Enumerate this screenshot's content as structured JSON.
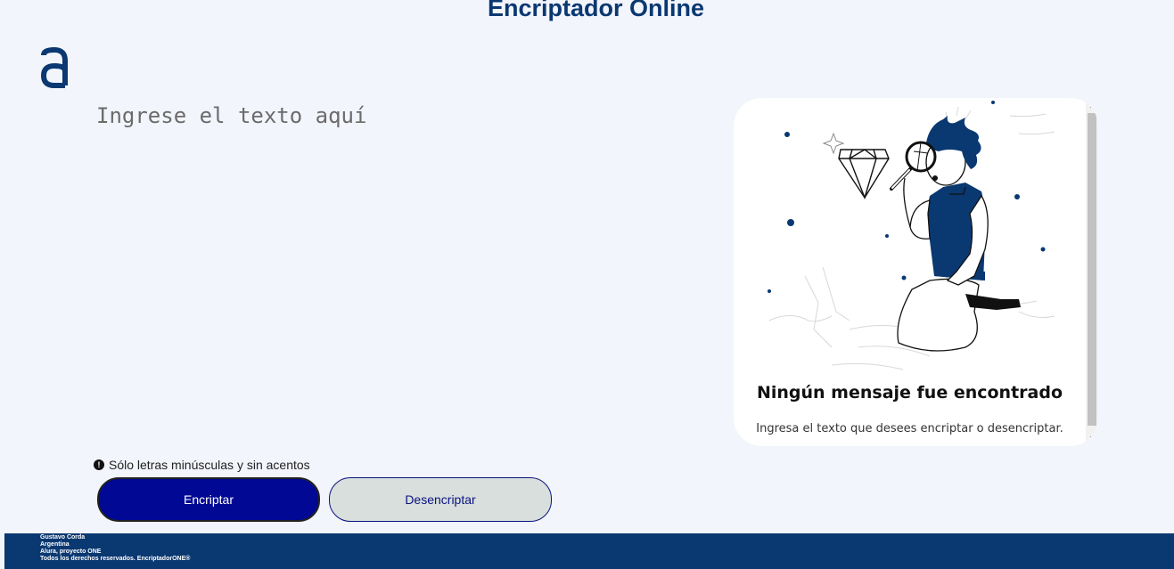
{
  "header": {
    "title": "Encriptador Online"
  },
  "logo": {
    "icon": "alura-logo-icon",
    "color": "#0a3871"
  },
  "input": {
    "placeholder": "Ingrese el texto aquí",
    "value": ""
  },
  "hint": {
    "icon": "info-icon",
    "icon_symbol": "!",
    "text": "Sólo letras minúsculas y sin acentos"
  },
  "buttons": {
    "encrypt": "Encriptar",
    "decrypt": "Desencriptar"
  },
  "output": {
    "illustration": "person-with-magnifier-illustration",
    "heading": "Ningún mensaje fue encontrado",
    "text": "Ingresa el texto que desees encriptar o desencriptar.",
    "scroll_up": "▲",
    "scroll_down": "▼"
  },
  "footer": {
    "lines": [
      "Gustavo Corda",
      "Argentina",
      "Alura, proyecto ONE",
      "Todos los derechos reservados. EncriptadorONE®"
    ]
  },
  "colors": {
    "primary": "#0a3871",
    "background": "#f3f5fc",
    "encrypt_button": "#000894",
    "decrypt_button": "#d8dfdc"
  }
}
